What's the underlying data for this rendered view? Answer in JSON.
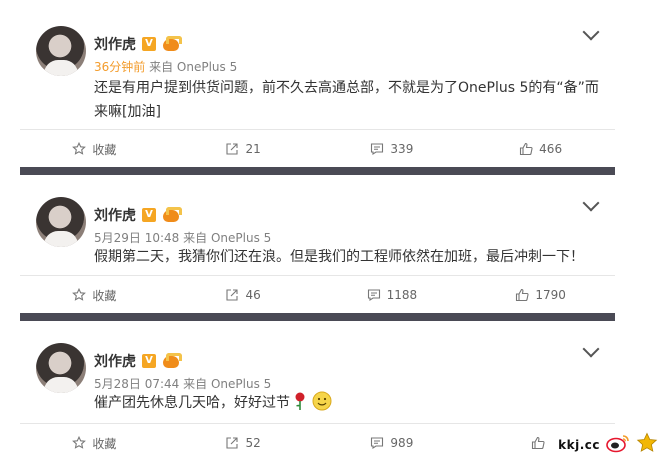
{
  "posts": [
    {
      "author": "刘作虎",
      "time": "36分钟前",
      "source": "来自 OnePlus 5",
      "text": "还是有用户提到供货问题，前不久去高通总部，不就是为了OnePlus 5的有“备”而来嘛[加油]",
      "actions": {
        "fav": "收藏",
        "repost": "21",
        "comment": "339",
        "like": "466"
      }
    },
    {
      "author": "刘作虎",
      "time": "5月29日 10:48",
      "source": "来自 OnePlus 5",
      "text": "假期第二天，我猜你们还在浪。但是我们的工程师依然在加班，最后冲刺一下！",
      "actions": {
        "fav": "收藏",
        "repost": "46",
        "comment": "1188",
        "like": "1790"
      }
    },
    {
      "author": "刘作虎",
      "time": "5月28日 07:44",
      "source": "来自 OnePlus 5",
      "text": "催产团先休息几天哈，好好过节",
      "actions": {
        "fav": "收藏",
        "repost": "52",
        "comment": "989",
        "like": ""
      }
    }
  ],
  "badge_v": "V",
  "watermark": "kkj.cc",
  "colors": {
    "time_accent": "#f39c2c",
    "separator": "#4a4a55",
    "v_badge": "#f5a623"
  }
}
